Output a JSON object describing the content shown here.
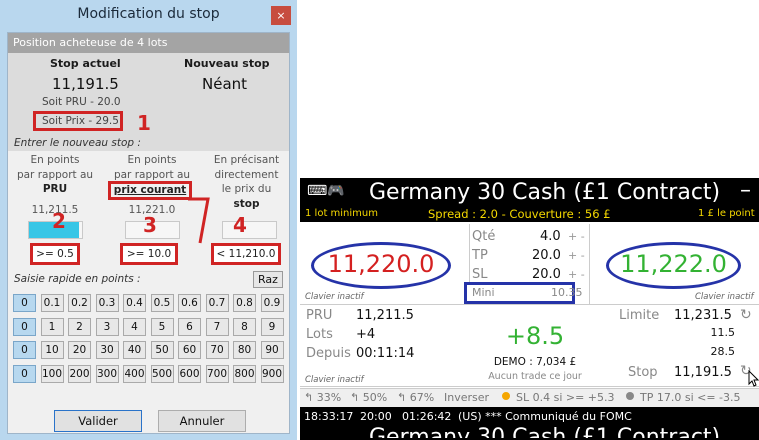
{
  "dialog": {
    "title": "Modification du stop",
    "close_glyph": "×",
    "position_label": "Position acheteuse de 4 lots",
    "stop_current_label": "Stop actuel",
    "stop_current_value": "11,191.5",
    "stop_current_pru": "Soit PRU - 20.0",
    "stop_current_prix": "Soit Prix - 29.5",
    "stop_new_label": "Nouveau stop",
    "stop_new_value": "Néant",
    "enter_label": "Entrer le nouveau stop :",
    "columns": [
      {
        "line1": "En points",
        "line2": "par rapport au",
        "line3": "PRU",
        "value": "11,211.5",
        "slider_fill_pct": 95,
        "condition": ">= 0.5",
        "annotation": "2"
      },
      {
        "line1": "En points",
        "line2": "par rapport au",
        "line3": "prix courant",
        "value": "11,221.0",
        "slider_fill_pct": 0,
        "condition": ">= 10.0",
        "annotation": "3"
      },
      {
        "line1": "En précisant",
        "line2": "directement",
        "line3": "le prix du",
        "line4": "stop",
        "condition": "< 11,210.0",
        "annotation": "4"
      }
    ],
    "annotation_1": "1",
    "quick_label": "Saisie rapide en points :",
    "raz_label": "Raz",
    "quick_rows": [
      [
        "0",
        "0.1",
        "0.2",
        "0.3",
        "0.4",
        "0.5",
        "0.6",
        "0.7",
        "0.8",
        "0.9"
      ],
      [
        "0",
        "1",
        "2",
        "3",
        "4",
        "5",
        "6",
        "7",
        "8",
        "9"
      ],
      [
        "0",
        "10",
        "20",
        "30",
        "40",
        "50",
        "60",
        "70",
        "80",
        "90"
      ],
      [
        "0",
        "100",
        "200",
        "300",
        "400",
        "500",
        "600",
        "700",
        "800",
        "900"
      ]
    ],
    "validate_label": "Valider",
    "cancel_label": "Annuler"
  },
  "panel": {
    "icons_glyph": "⌨🎮",
    "title": "Germany 30 Cash (£1 Contract)",
    "title_dash": "–",
    "min_lot": "1 lot minimum",
    "spread": "Spread : 2.0 - Couverture : 56 £",
    "point_value": "1 £ le point",
    "sell_price": "11,220.0",
    "buy_price": "11,222.0",
    "sell_price_color": "#d42020",
    "buy_price_color": "#33b233",
    "keyboard_inactive": "Clavier inactif",
    "qty_label": "Qté",
    "qty_value": "4.0",
    "tp_label": "TP",
    "tp_value": "20.0",
    "sl_label": "SL",
    "sl_value": "20.0",
    "mini_label": "Mini",
    "mini_value": "10.35",
    "plus_minus": "+ -",
    "pru_label": "PRU",
    "pru_value": "11,211.5",
    "lots_label": "Lots",
    "lots_value": "+4",
    "since_label": "Depuis",
    "since_value": "00:11:14",
    "pnl": "+8.5",
    "pnl_color": "#33b233",
    "demo": "DEMO : 7,034 £",
    "no_trade": "Aucun trade ce jour",
    "limit_label": "Limite",
    "limit_value": "11,231.5",
    "limit_sub1": "11.5",
    "limit_sub2": "28.5",
    "stop_label": "Stop",
    "stop_value": "11,191.5",
    "tabs": [
      "↰ 33%",
      "↰ 50%",
      "↰ 67%",
      "Inverser",
      "SL 0.4 si >= +5.3",
      "TP 17.0 si <= -3.5"
    ],
    "news_time1": "18:33:17",
    "news_time2": "20:00",
    "news_time3": "01:26:42",
    "news_text": "(US) *** Communiqué du FOMC",
    "next_title": "Germany 30 Cash (£1 Contract)"
  }
}
